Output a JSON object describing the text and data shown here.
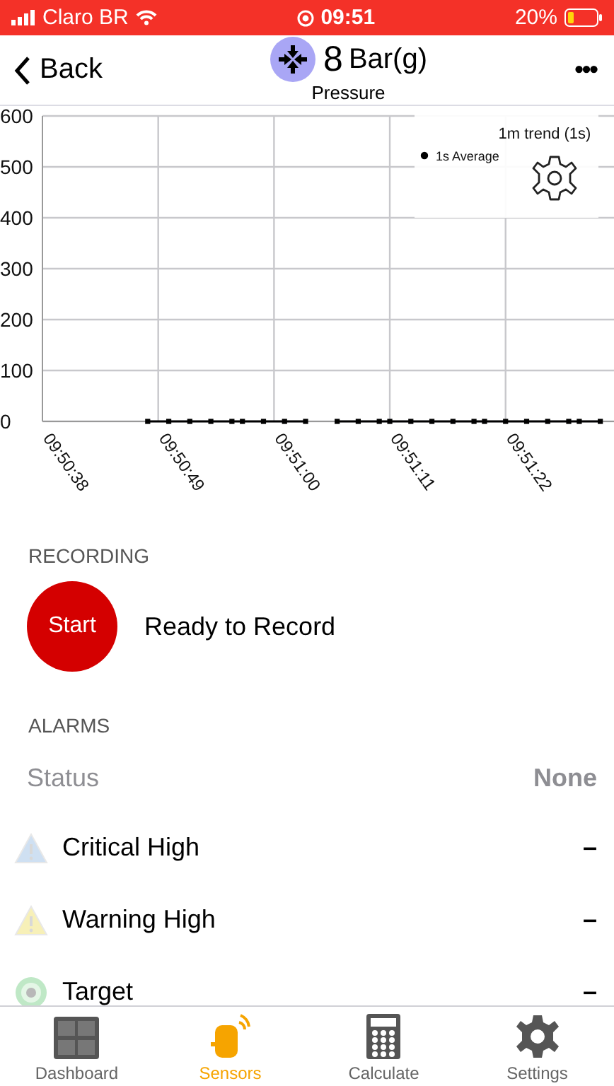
{
  "status_bar": {
    "carrier": "Claro BR",
    "time": "09:51",
    "battery": "20%"
  },
  "nav": {
    "back": "Back",
    "value": "8",
    "unit": "Bar(g)",
    "subtitle": "Pressure",
    "more": "•••"
  },
  "chart": {
    "legend_title": "1m trend (1s)",
    "chart_data": {
      "type": "line",
      "grid": true,
      "categories": [
        "09:50:38",
        null,
        null,
        null,
        null,
        null,
        null,
        null,
        null,
        null,
        null,
        "09:50:49",
        null,
        null,
        null,
        null,
        null,
        null,
        null,
        null,
        null,
        null,
        "09:51:00",
        null,
        null,
        null,
        null,
        null,
        null,
        null,
        null,
        null,
        null,
        "09:51:11",
        null,
        null,
        null,
        null,
        null,
        null,
        null,
        null,
        null,
        null,
        "09:51:22",
        null,
        null,
        null,
        null,
        null,
        null,
        null,
        null,
        null,
        null
      ],
      "series": [
        {
          "name": "1s Average",
          "color": "#000000",
          "marker": "square",
          "values": [
            null,
            null,
            null,
            null,
            null,
            null,
            null,
            null,
            null,
            null,
            0,
            null,
            0,
            null,
            0,
            null,
            0,
            null,
            0,
            0,
            null,
            0,
            null,
            0,
            null,
            0,
            null,
            null,
            0,
            null,
            0,
            null,
            0,
            0,
            null,
            0,
            null,
            0,
            null,
            0,
            null,
            0,
            0,
            null,
            0,
            null,
            0,
            null,
            0,
            null,
            0,
            0,
            null,
            0,
            null
          ]
        }
      ],
      "ylim": [
        0,
        600
      ],
      "yticks": [
        0,
        100,
        200,
        300,
        400,
        500,
        600
      ]
    }
  },
  "recording": {
    "heading": "RECORDING",
    "button": "Start",
    "state": "Ready to Record"
  },
  "alarms": {
    "heading": "ALARMS",
    "status_label": "Status",
    "status_value": "None",
    "rows": [
      {
        "kind": "critical",
        "label": "Critical High",
        "value": "–"
      },
      {
        "kind": "warning",
        "label": "Warning High",
        "value": "–"
      },
      {
        "kind": "target",
        "label": "Target",
        "value": "–"
      }
    ]
  },
  "tabs": [
    {
      "label": "Dashboard",
      "kind": "grid",
      "selected": false
    },
    {
      "label": "Sensors",
      "kind": "sensor",
      "selected": true
    },
    {
      "label": "Calculate",
      "kind": "calculator",
      "selected": false
    },
    {
      "label": "Settings",
      "kind": "gear",
      "selected": false
    }
  ]
}
